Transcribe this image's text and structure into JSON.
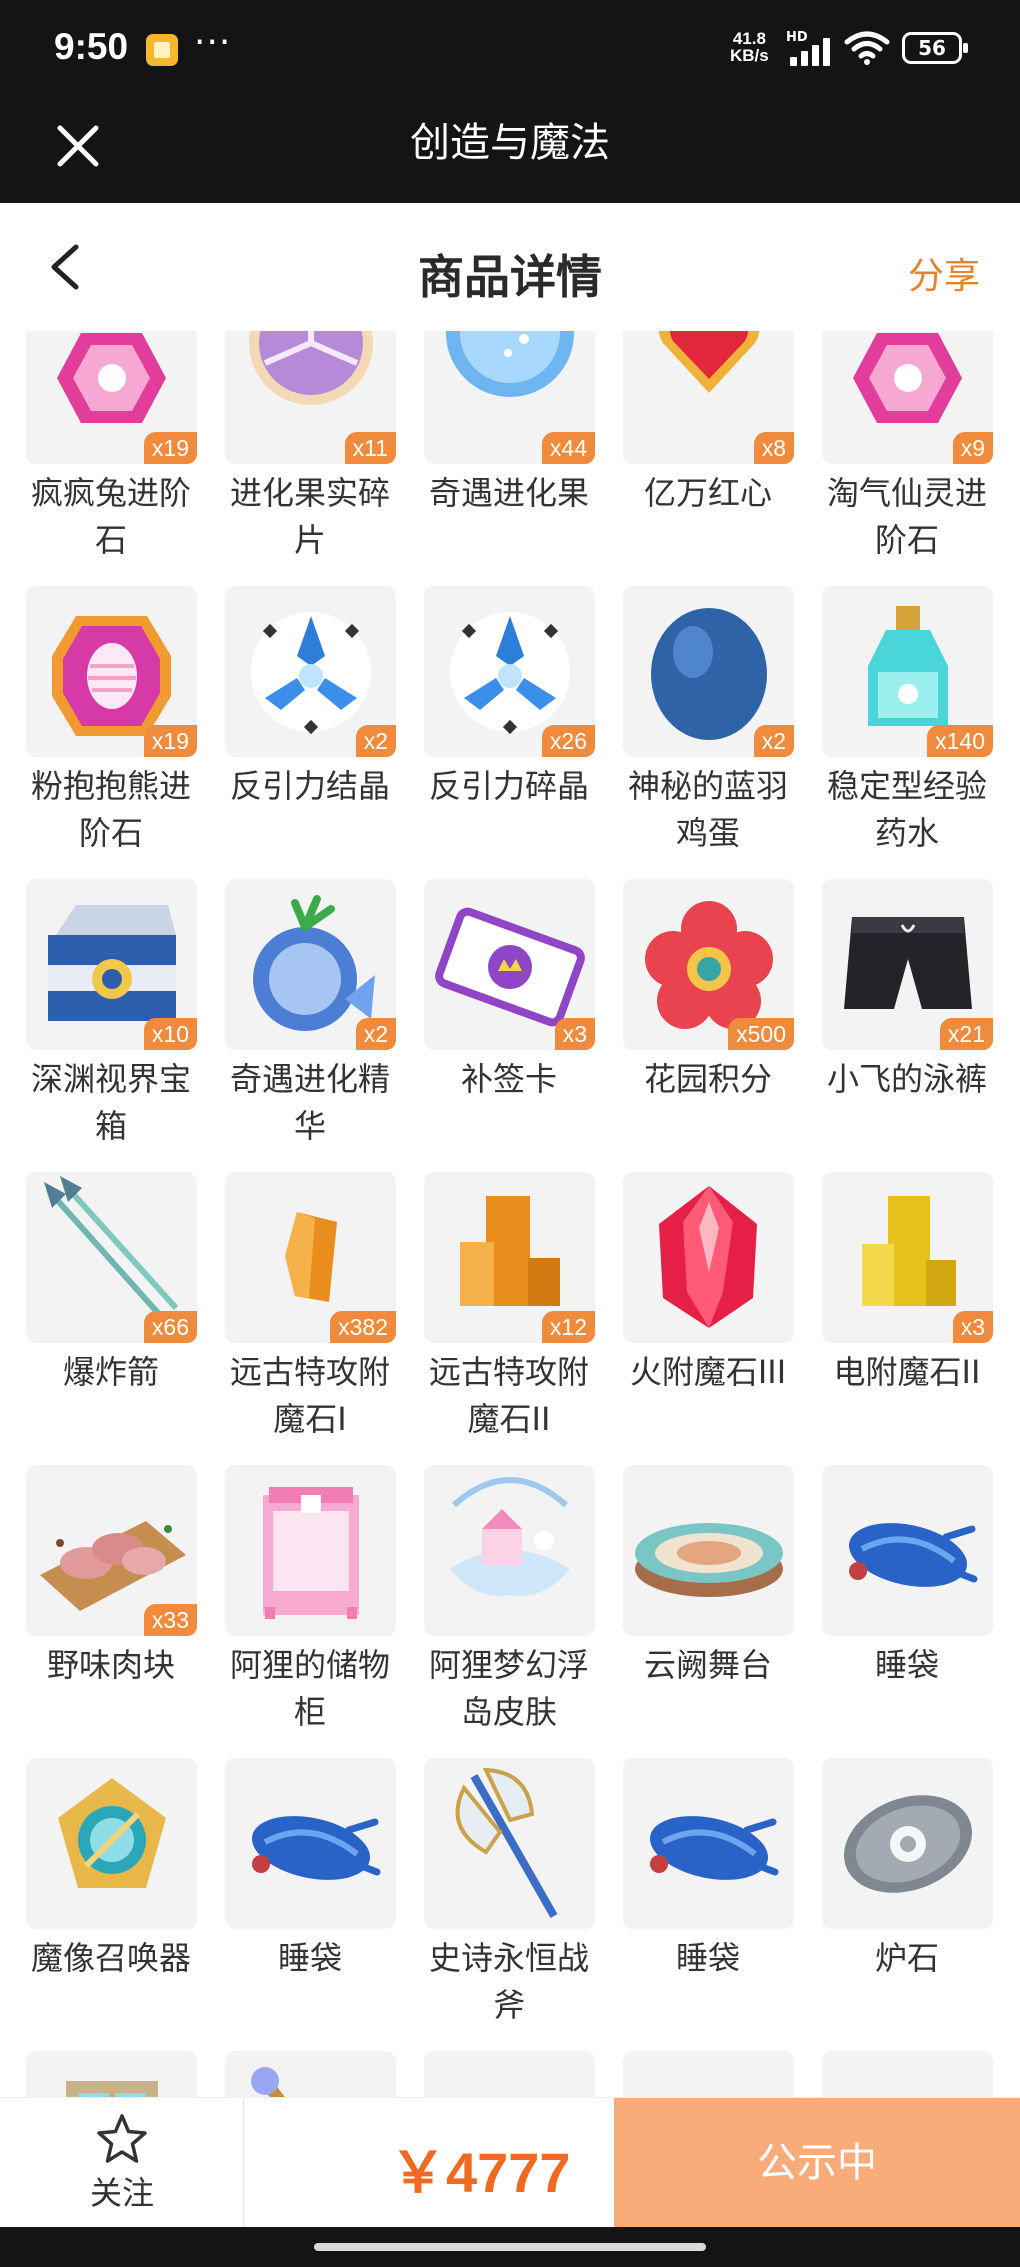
{
  "status_bar": {
    "time": "9:50",
    "dots": "···",
    "net_speed_value": "41.8",
    "net_speed_unit": "KB/s",
    "hd_label": "HD",
    "battery": "56"
  },
  "title_bar": {
    "title": "创造与魔法"
  },
  "header": {
    "title": "商品详情",
    "share_label": "分享"
  },
  "items": [
    {
      "name": "疯疯兔进阶石",
      "count": "x19",
      "icon": "pink-crystal"
    },
    {
      "name": "进化果实碎片",
      "count": "x11",
      "icon": "fruit-slice"
    },
    {
      "name": "奇遇进化果",
      "count": "x44",
      "icon": "blue-orb"
    },
    {
      "name": "亿万红心",
      "count": "x8",
      "icon": "red-heart"
    },
    {
      "name": "淘气仙灵进阶石",
      "count": "x9",
      "icon": "pink-crystal"
    },
    {
      "name": "粉抱抱熊进阶石",
      "count": "x19",
      "icon": "egg-crystal"
    },
    {
      "name": "反引力结晶",
      "count": "x2",
      "icon": "antigravity-crystal"
    },
    {
      "name": "反引力碎晶",
      "count": "x26",
      "icon": "antigravity-crystal"
    },
    {
      "name": "神秘的蓝羽鸡蛋",
      "count": "x2",
      "icon": "blue-egg"
    },
    {
      "name": "稳定型经验药水",
      "count": "x140",
      "icon": "potion-bottle"
    },
    {
      "name": "深渊视界宝箱",
      "count": "x10",
      "icon": "treasure-chest"
    },
    {
      "name": "奇遇进化精华",
      "count": "x2",
      "icon": "blue-fruit"
    },
    {
      "name": "补签卡",
      "count": "x3",
      "icon": "purple-ticket"
    },
    {
      "name": "花园积分",
      "count": "x500",
      "icon": "red-flower"
    },
    {
      "name": "小飞的泳裤",
      "count": "x21",
      "icon": "swim-shorts"
    },
    {
      "name": "爆炸箭",
      "count": "x66",
      "icon": "arrows"
    },
    {
      "name": "远古特攻附魔石I",
      "count": "x382",
      "icon": "orange-stone"
    },
    {
      "name": "远古特攻附魔石II",
      "count": "x12",
      "icon": "orange-stones"
    },
    {
      "name": "火附魔石III",
      "count": "",
      "icon": "red-crystal"
    },
    {
      "name": "电附魔石II",
      "count": "x3",
      "icon": "yellow-stones"
    },
    {
      "name": "野味肉块",
      "count": "x33",
      "icon": "meat-tray"
    },
    {
      "name": "阿狸的储物柜",
      "count": "",
      "icon": "pink-cabinet"
    },
    {
      "name": "阿狸梦幻浮岛皮肤",
      "count": "",
      "icon": "floating-island"
    },
    {
      "name": "云阙舞台",
      "count": "",
      "icon": "round-stage"
    },
    {
      "name": "睡袋",
      "count": "",
      "icon": "blue-sleeping-bag"
    },
    {
      "name": "魔像召唤器",
      "count": "",
      "icon": "golem-summoner"
    },
    {
      "name": "睡袋",
      "count": "",
      "icon": "blue-sleeping-bag"
    },
    {
      "name": "史诗永恒战斧",
      "count": "",
      "icon": "battle-axe"
    },
    {
      "name": "睡袋",
      "count": "",
      "icon": "blue-sleeping-bag"
    },
    {
      "name": "炉石",
      "count": "",
      "icon": "hearthstone"
    },
    {
      "name": "",
      "count": "",
      "icon": "crystal-door"
    },
    {
      "name": "",
      "count": "",
      "icon": "staff"
    },
    {
      "name": "",
      "count": "",
      "icon": "stew-bowl"
    },
    {
      "name": "",
      "count": "",
      "icon": "red-bag"
    },
    {
      "name": "",
      "count": "",
      "icon": "blue-sleeping-bag"
    }
  ],
  "bottom_bar": {
    "follow_label": "关注",
    "price": "￥4777",
    "status_label": "公示中"
  },
  "colors": {
    "accent": "#e5832a",
    "price": "#ef6a1f",
    "badge": "#f08b3e",
    "status_button": "#f9ab7a",
    "dark_bar": "#141414"
  }
}
